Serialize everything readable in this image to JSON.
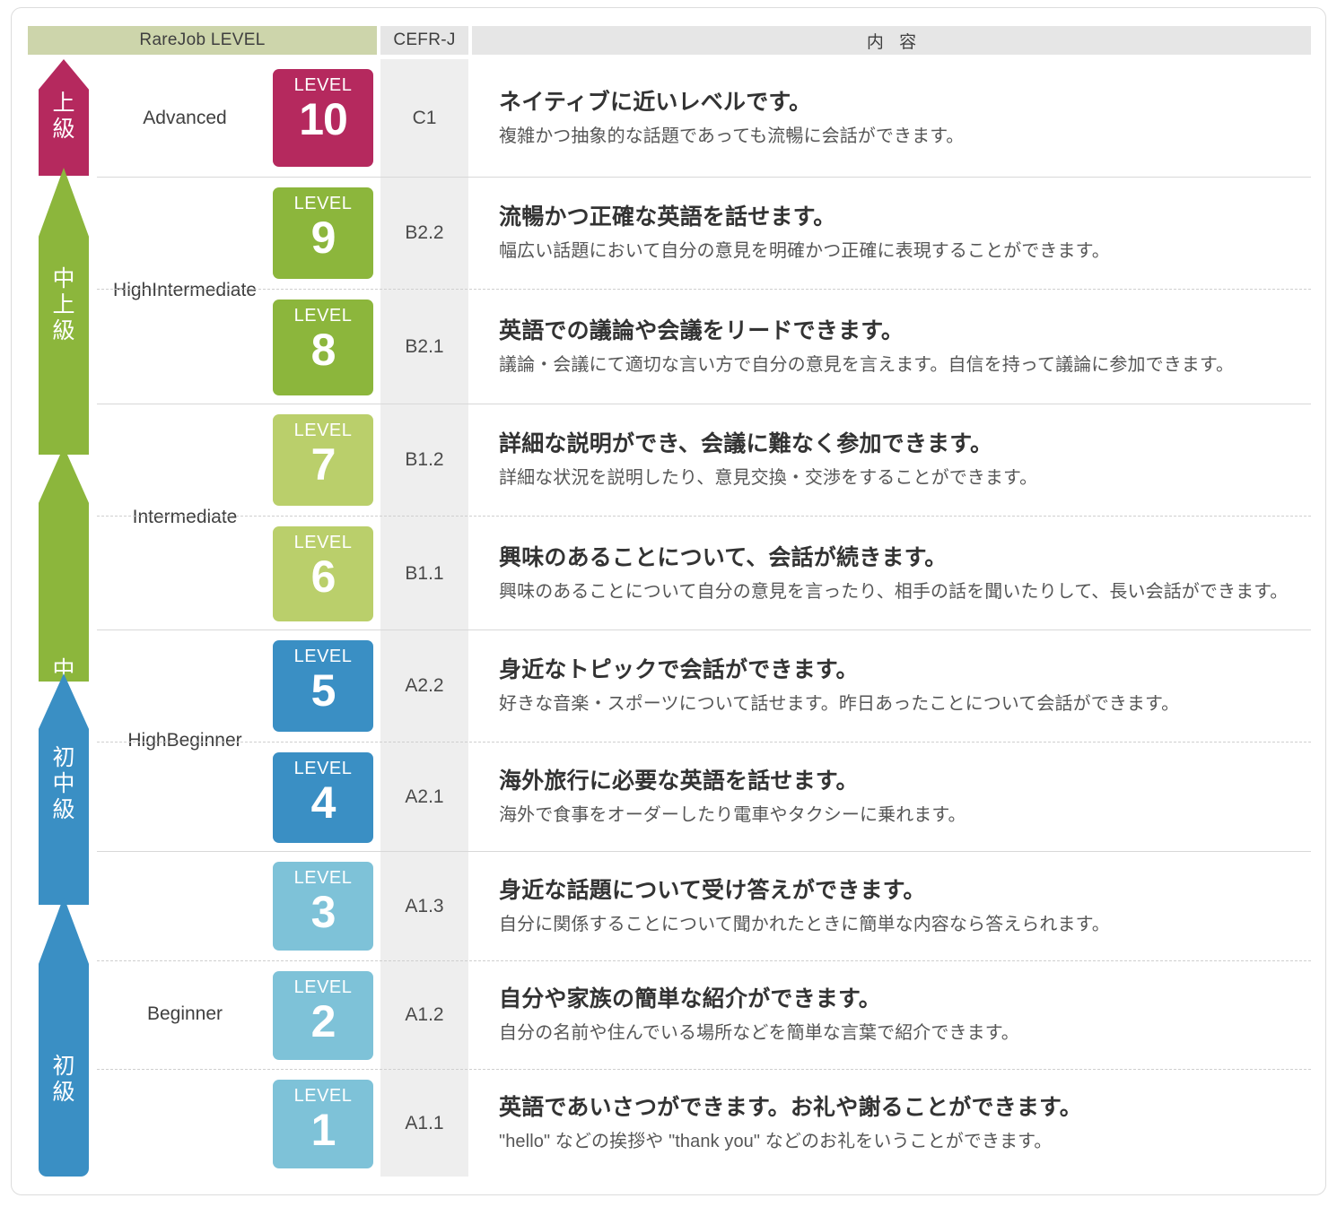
{
  "header": {
    "col_level": "RareJob LEVEL",
    "col_cefr": "CEFR-J",
    "col_content": "内 容"
  },
  "colors": {
    "advanced": "#b5295e",
    "high_intermediate": "#8cb63c",
    "intermediate": "#bacf6b",
    "high_beginner": "#3a8fc4",
    "beginner": "#7ec2d8",
    "header_level_bg": "#cdd5ab",
    "header_other_bg": "#e6e6e6",
    "cefr_bg": "#eeeeee"
  },
  "rail": [
    {
      "label": "上級",
      "color": "#b5295e",
      "group": "advanced"
    },
    {
      "label": "中上級",
      "color": "#8cb63c",
      "group": "high-intermediate"
    },
    {
      "label": "中級",
      "color": "#8cb63c",
      "group": "intermediate"
    },
    {
      "label": "初中級",
      "color": "#3a8fc4",
      "group": "high-beginner"
    },
    {
      "label": "初級",
      "color": "#3a8fc4",
      "group": "beginner"
    }
  ],
  "groups": [
    {
      "name": "Advanced",
      "badge_color": "#b5295e",
      "rows": [
        {
          "level_word": "LEVEL",
          "level_number": "10",
          "cefr": "C1",
          "title": "ネイティブに近いレベルです。",
          "desc": "複雑かつ抽象的な話題であっても流暢に会話ができます。"
        }
      ]
    },
    {
      "name": "High\nIntermediate",
      "badge_color": "#8cb63c",
      "rows": [
        {
          "level_word": "LEVEL",
          "level_number": "9",
          "cefr": "B2.2",
          "title": "流暢かつ正確な英語を話せます。",
          "desc": "幅広い話題において自分の意見を明確かつ正確に表現することができます。"
        },
        {
          "level_word": "LEVEL",
          "level_number": "8",
          "cefr": "B2.1",
          "title": "英語での議論や会議をリードできます。",
          "desc": "議論・会議にて適切な言い方で自分の意見を言えます。自信を持って議論に参加できます。"
        }
      ]
    },
    {
      "name": "Intermediate",
      "badge_color": "#bacf6b",
      "rows": [
        {
          "level_word": "LEVEL",
          "level_number": "7",
          "cefr": "B1.2",
          "title": "詳細な説明ができ、会議に難なく参加できます。",
          "desc": "詳細な状況を説明したり、意見交換・交渉をすることができます。"
        },
        {
          "level_word": "LEVEL",
          "level_number": "6",
          "cefr": "B1.1",
          "title": "興味のあることについて、会話が続きます。",
          "desc": "興味のあることについて自分の意見を言ったり、相手の話を聞いたりして、長い会話ができます。"
        }
      ]
    },
    {
      "name": "High\nBeginner",
      "badge_color": "#3a8fc4",
      "rows": [
        {
          "level_word": "LEVEL",
          "level_number": "5",
          "cefr": "A2.2",
          "title": "身近なトピックで会話ができます。",
          "desc": "好きな音楽・スポーツについて話せます。昨日あったことについて会話ができます。"
        },
        {
          "level_word": "LEVEL",
          "level_number": "4",
          "cefr": "A2.1",
          "title": "海外旅行に必要な英語を話せます。",
          "desc": "海外で食事をオーダーしたり電車やタクシーに乗れます。"
        }
      ]
    },
    {
      "name": "Beginner",
      "badge_color": "#7ec2d8",
      "rows": [
        {
          "level_word": "LEVEL",
          "level_number": "3",
          "cefr": "A1.3",
          "title": "身近な話題について受け答えができます。",
          "desc": "自分に関係することについて聞かれたときに簡単な内容なら答えられます。"
        },
        {
          "level_word": "LEVEL",
          "level_number": "2",
          "cefr": "A1.2",
          "title": "自分や家族の簡単な紹介ができます。",
          "desc": "自分の名前や住んでいる場所などを簡単な言葉で紹介できます。"
        },
        {
          "level_word": "LEVEL",
          "level_number": "1",
          "cefr": "A1.1",
          "title": "英語であいさつができます。お礼や謝ることができます。",
          "desc": "\"hello\" などの挨拶や \"thank you\" などのお礼をいうことができます。"
        }
      ]
    }
  ]
}
